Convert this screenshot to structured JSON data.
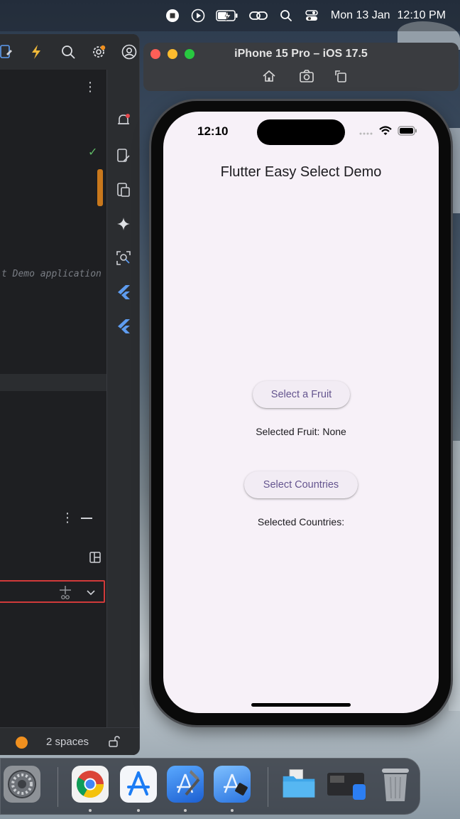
{
  "menubar": {
    "date": "Mon 13 Jan",
    "time": "12:10 PM",
    "icons": [
      "record-stop-icon",
      "play-icon",
      "battery-charging-icon",
      "link-icon",
      "search-icon",
      "control-center-icon"
    ]
  },
  "ide": {
    "code_comment": "t Demo application",
    "status": {
      "indent": "2 spaces"
    },
    "colors": {
      "status_dot": "#f0901f",
      "input_border": "#d13a3a",
      "scroll_thumb": "#c9781c"
    }
  },
  "simulator": {
    "title": "iPhone 15 Pro – iOS 17.5",
    "tools": [
      "home-icon",
      "screenshot-icon",
      "rotate-icon"
    ]
  },
  "phone": {
    "status_time": "12:10",
    "app_title": "Flutter Easy Select Demo",
    "fruit_button": "Select a Fruit",
    "fruit_result": "Selected Fruit: None",
    "countries_button": "Select Countries",
    "countries_result": "Selected Countries:",
    "colors": {
      "button_text": "#65558f",
      "background": "#f7f1f8"
    }
  },
  "dock": {
    "apps": [
      "system-settings",
      "google-chrome",
      "app-store",
      "xcode",
      "xcode-beta",
      "finder-folder",
      "simulator",
      "trash"
    ]
  }
}
